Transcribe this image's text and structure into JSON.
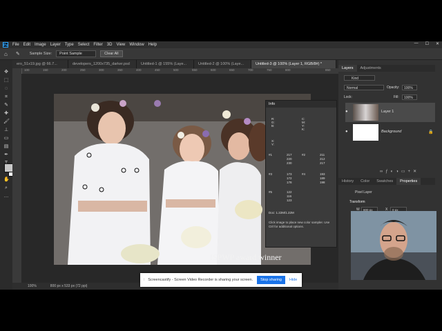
{
  "menubar": {
    "logo": "Ps",
    "items": [
      "File",
      "Edit",
      "Image",
      "Layer",
      "Type",
      "Select",
      "Filter",
      "3D",
      "View",
      "Window",
      "Help"
    ],
    "window_controls": [
      "—",
      "☐",
      "✕"
    ]
  },
  "options": {
    "sample_size_label": "Sample Size:",
    "sample_size_value": "Point Sample",
    "clear_all": "Clear All"
  },
  "tabs": [
    {
      "label": "ero_51x19.jpg @ 66.7...",
      "active": false
    },
    {
      "label": "developers_1200x735_darker.psd",
      "active": false
    },
    {
      "label": "Untitled-1 @ 155% (Laye...",
      "active": false
    },
    {
      "label": "Untitled-2 @ 100% (Laye...",
      "active": false
    },
    {
      "label": "Untitled-3 @ 100% (Layer 1, RGB/8#) *",
      "active": true
    }
  ],
  "ruler_h": [
    "100",
    "150",
    "200",
    "250",
    "300",
    "350",
    "400",
    "450",
    "500",
    "550",
    "600",
    "650",
    "700",
    "750",
    "800",
    "850"
  ],
  "watermark": "ISPWP award winner",
  "statusbar": {
    "zoom": "100%",
    "dims": "800 px x 533 px (72 ppi)"
  },
  "info_panel": {
    "title": "Info",
    "doc": "Doc: 1.22M/1.22M",
    "hint": "Click image to place new color sampler. Use Ctrl for additional options.",
    "rgb_block": [
      {
        "label": "#1",
        "r": "217",
        "g": "220",
        "b": "230"
      },
      {
        "label": "#2",
        "r": "211",
        "g": "212",
        "b": "217"
      },
      {
        "label": "#3",
        "r": "173",
        "g": "172",
        "b": "178"
      },
      {
        "label": "#4",
        "r": "193",
        "g": "189",
        "b": "198"
      },
      {
        "label": "#5",
        "r": "122",
        "g": "116",
        "b": "123"
      }
    ]
  },
  "layers_panel": {
    "tabs": [
      "Layers",
      "Adjustments"
    ],
    "blend_mode": "Normal",
    "opacity_label": "Opacity:",
    "opacity_value": "100%",
    "lock_label": "Lock:",
    "fill_label": "Fill:",
    "fill_value": "100%",
    "kind": "Kind",
    "layers": [
      {
        "name": "Layer 1",
        "active": true
      },
      {
        "name": "Background",
        "active": false
      }
    ]
  },
  "properties_panel": {
    "tabs": [
      "History",
      "Color",
      "Swatches",
      "Properties"
    ],
    "layer_type": "Pixel Layer",
    "section": "Transform",
    "w_label": "W",
    "w_value": "800 px",
    "x_label": "X",
    "x_value": "0 px"
  },
  "share_bar": {
    "message": "Screencastify - Screen Video Recorder is sharing your screen.",
    "stop": "Stop sharing",
    "hide": "Hide"
  },
  "colors": {
    "accent": "#31a8ff",
    "panel": "#323232",
    "share_button": "#1a73e8"
  }
}
